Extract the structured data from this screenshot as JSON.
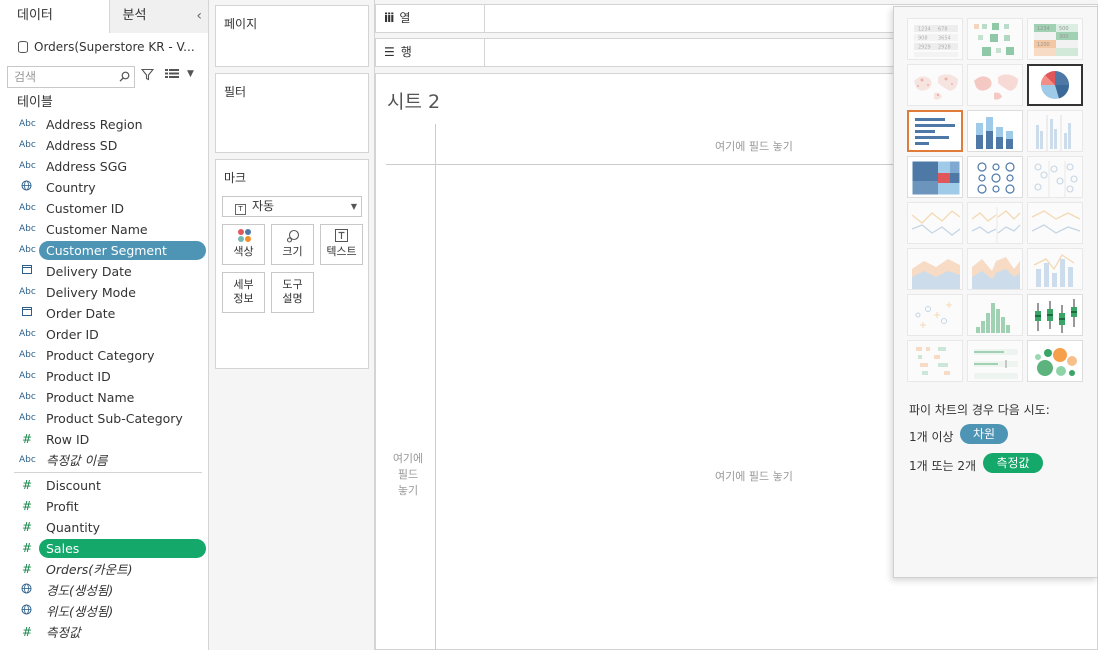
{
  "data_pane": {
    "tab_data": "데이터",
    "tab_analysis": "분석",
    "collapse_glyph": "‹",
    "datasource": "Orders(Superstore KR - V...",
    "search_placeholder": "검색",
    "tables_title": "테이블",
    "dimensions": [
      {
        "type": "Abc",
        "label": "Address Region"
      },
      {
        "type": "Abc",
        "label": "Address SD"
      },
      {
        "type": "Abc",
        "label": "Address SGG"
      },
      {
        "type": "globe",
        "label": "Country"
      },
      {
        "type": "Abc",
        "label": "Customer ID"
      },
      {
        "type": "Abc",
        "label": "Customer Name"
      },
      {
        "type": "Abc",
        "label": "Customer Segment"
      },
      {
        "type": "cal",
        "label": "Delivery Date"
      },
      {
        "type": "Abc",
        "label": "Delivery Mode"
      },
      {
        "type": "cal",
        "label": "Order Date"
      },
      {
        "type": "Abc",
        "label": "Order ID"
      },
      {
        "type": "Abc",
        "label": "Product Category"
      },
      {
        "type": "Abc",
        "label": "Product ID"
      },
      {
        "type": "Abc",
        "label": "Product Name"
      },
      {
        "type": "Abc",
        "label": "Product Sub-Category"
      },
      {
        "type": "#",
        "label": "Row ID"
      },
      {
        "type": "Abc",
        "label": "측정값 이름"
      }
    ],
    "measures": [
      {
        "type": "#",
        "label": "Discount"
      },
      {
        "type": "#",
        "label": "Profit"
      },
      {
        "type": "#",
        "label": "Quantity"
      },
      {
        "type": "#",
        "label": "Sales"
      },
      {
        "type": "#",
        "label": "Orders(카운트)"
      },
      {
        "type": "globe",
        "label": "경도(생성됨)"
      },
      {
        "type": "globe",
        "label": "위도(생성됨)"
      },
      {
        "type": "#",
        "label": "측정값"
      }
    ]
  },
  "cards": {
    "pages": "페이지",
    "filters": "필터",
    "marks": "마크",
    "marks_type": "자동",
    "marks_buttons": {
      "color": "색상",
      "size": "크기",
      "label": "텍스트",
      "detail_1": "세부",
      "detail_2": "정보",
      "tooltip_1": "도구",
      "tooltip_2": "설명"
    }
  },
  "shelves": {
    "columns": "열",
    "rows": "행"
  },
  "sheet": {
    "title": "시트 2",
    "drop_field_top": "여기에 필드 놓기",
    "drop_field_center": "여기에 필드 놓기",
    "drop_field_left_1": "여기에",
    "drop_field_left_2": "필드",
    "drop_field_left_3": "놓기"
  },
  "show_me": {
    "hint_title": "파이 차트의 경우 다음 시도:",
    "req1_text": "1개 이상",
    "req1_pill": "차원",
    "req2_text": "1개 또는 2개",
    "req2_pill": "측정값",
    "selected_chart": "pie-chart",
    "colors": {
      "dimension_pill": "#4d94b5",
      "measure_pill": "#14a86a",
      "highlight": "#e07b39"
    }
  }
}
